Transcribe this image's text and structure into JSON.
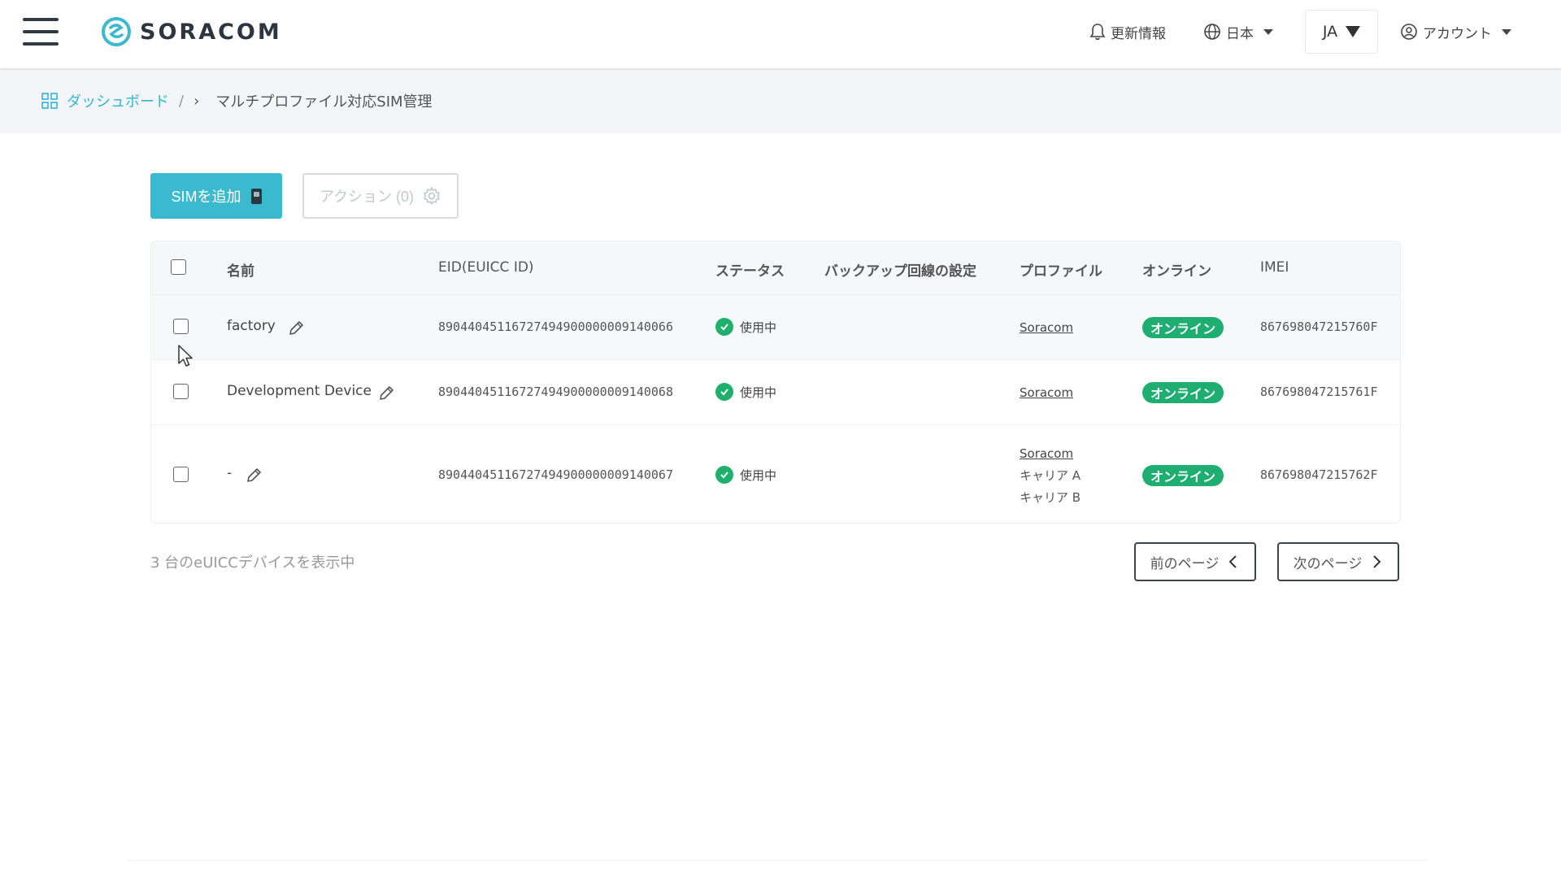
{
  "header": {
    "logo_text": "SORACOM",
    "news_label": "更新情報",
    "region_label": "日本",
    "lang_label": "JA",
    "account_label": "アカウント"
  },
  "breadcrumb": {
    "home_label": "ダッシュボード",
    "separator": "/",
    "chevron": "›",
    "current_label": "マルチプロファイル対応SIM管理"
  },
  "toolbar": {
    "add_sim_label": "SIMを追加",
    "action_label": "アクション (0)"
  },
  "table": {
    "columns": {
      "name": "名前",
      "eid": "EID(EUICC ID)",
      "status": "ステータス",
      "backup": "バックアップ回線の設定",
      "profile": "プロファイル",
      "online": "オンライン",
      "imei": "IMEI"
    },
    "rows": [
      {
        "name": "factory",
        "eid": "89044045116727494900000009140066",
        "status": "使用中",
        "profiles": [
          "Soracom"
        ],
        "online": "オンライン",
        "imei": "867698047215760F"
      },
      {
        "name": "Development Device",
        "eid": "89044045116727494900000009140068",
        "status": "使用中",
        "profiles": [
          "Soracom"
        ],
        "online": "オンライン",
        "imei": "867698047215761F"
      },
      {
        "name": "-",
        "eid": "89044045116727494900000009140067",
        "status": "使用中",
        "profiles": [
          "Soracom",
          "キャリア A",
          "キャリア B"
        ],
        "online": "オンライン",
        "imei": "867698047215762F"
      }
    ]
  },
  "footer": {
    "count_text": "3 台のeUICCデバイスを表示中",
    "prev_label": "前のページ",
    "next_label": "次のページ"
  },
  "colors": {
    "accent": "#3bb9cf",
    "online": "#1fae71",
    "status_ok": "#1fb06b",
    "link": "#34b6d3"
  },
  "icons": [
    "menu-icon",
    "soracom-logo-icon",
    "bell-icon",
    "globe-icon",
    "user-circle-icon",
    "dashboard-icon",
    "sim-card-icon",
    "gear-icon",
    "pencil-icon",
    "check-circle-icon",
    "chevron-left-icon",
    "chevron-right-icon",
    "mouse-cursor-icon"
  ]
}
